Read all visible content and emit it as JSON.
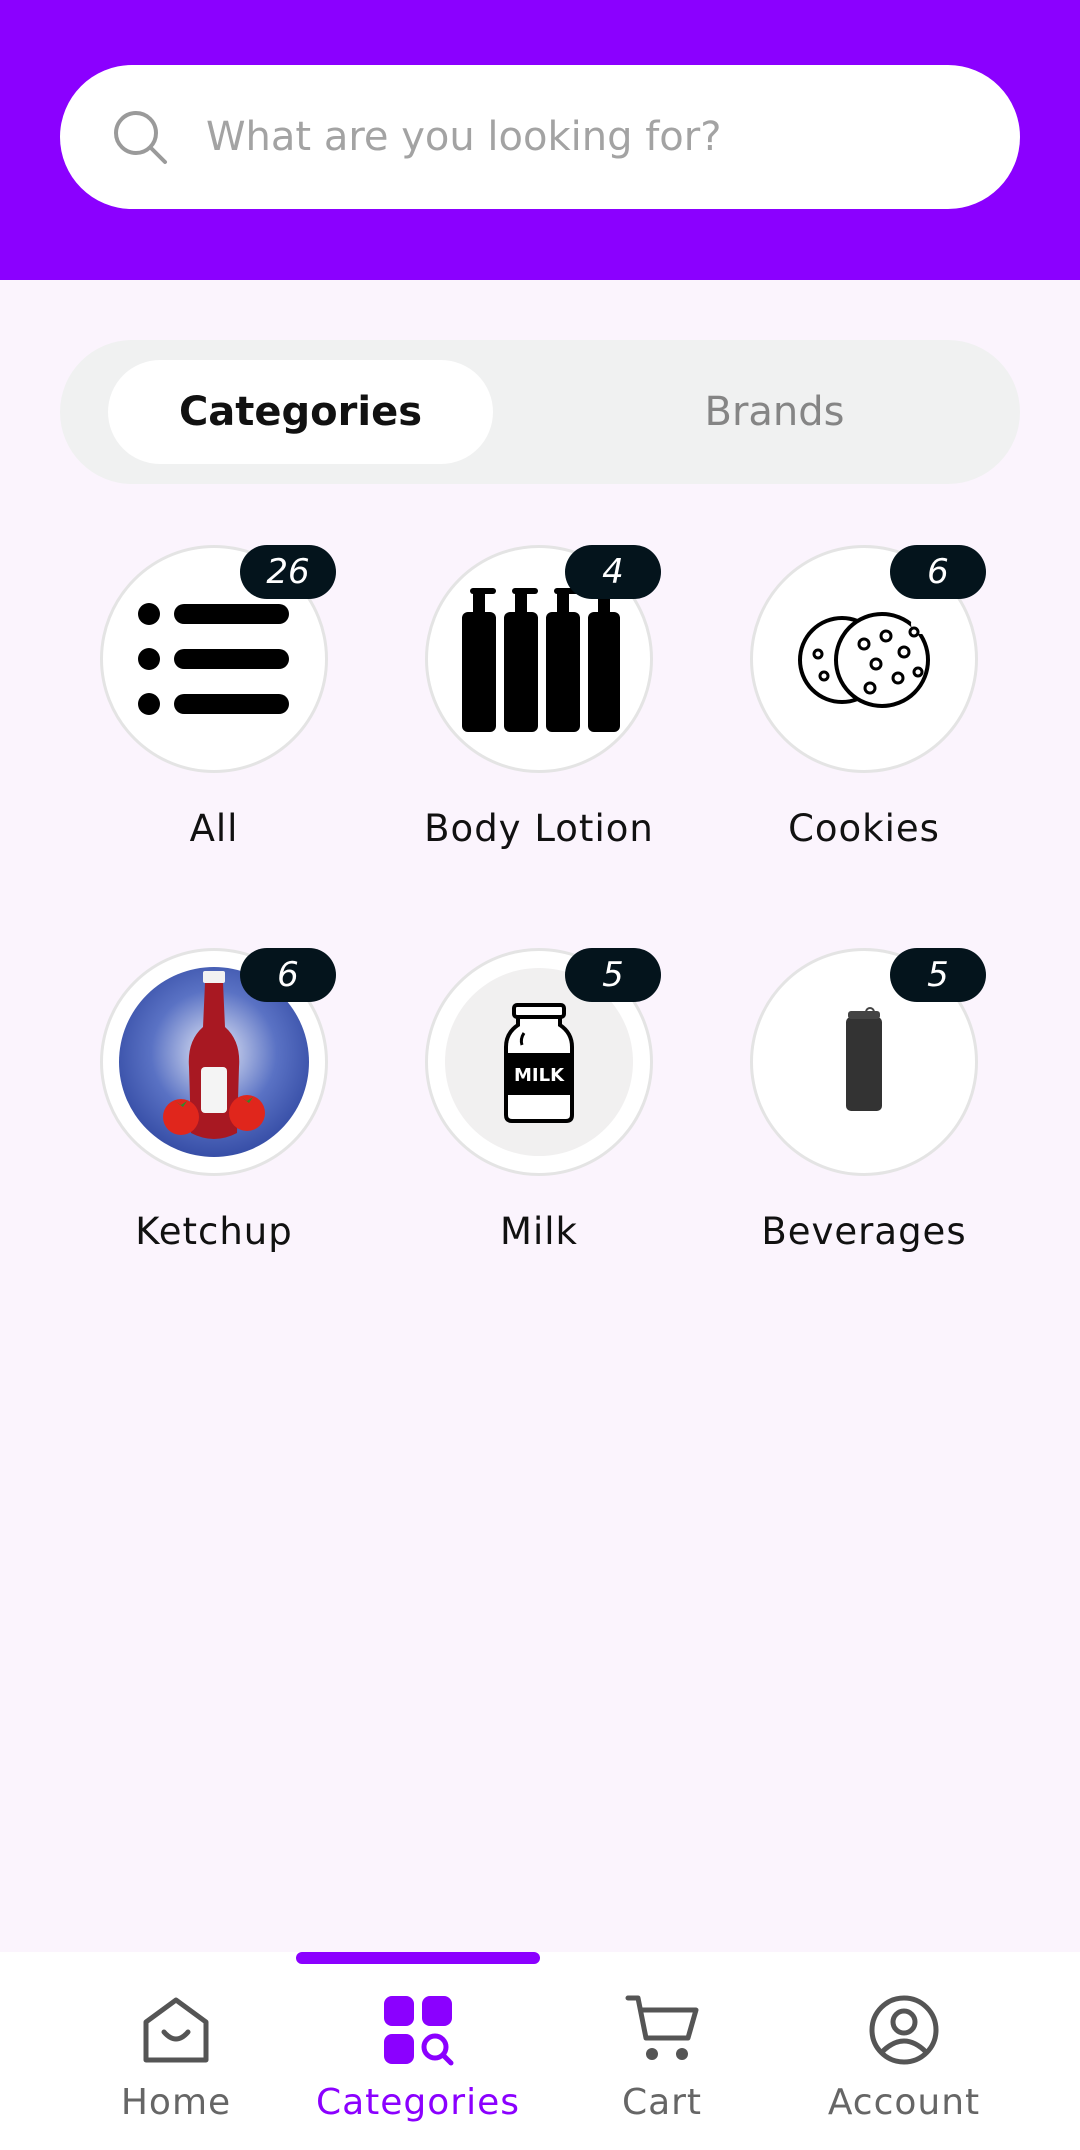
{
  "search": {
    "placeholder": "What are you looking for?",
    "icon": "search-icon"
  },
  "toggle": {
    "categories_label": "Categories",
    "brands_label": "Brands",
    "selected": "Categories"
  },
  "categories": [
    {
      "label": "All",
      "count": "26",
      "icon": "list-icon"
    },
    {
      "label": "Body Lotion",
      "count": "4",
      "icon": "lotion-bottles-icon"
    },
    {
      "label": "Cookies",
      "count": "6",
      "icon": "cookies-icon"
    },
    {
      "label": "Ketchup",
      "count": "6",
      "icon": "ketchup-bottle-image"
    },
    {
      "label": "Milk",
      "count": "5",
      "icon": "milk-bottle-icon"
    },
    {
      "label": "Beverages",
      "count": "5",
      "icon": "beverage-can-icon"
    }
  ],
  "nav": {
    "items": [
      {
        "label": "Home",
        "icon": "home-bag-icon"
      },
      {
        "label": "Categories",
        "icon": "categories-grid-icon"
      },
      {
        "label": "Cart",
        "icon": "cart-icon"
      },
      {
        "label": "Account",
        "icon": "account-icon"
      }
    ],
    "active": "Categories"
  },
  "colors": {
    "brand": "#8b00ff",
    "background": "#fbf4fd",
    "badge": "#04141c"
  }
}
